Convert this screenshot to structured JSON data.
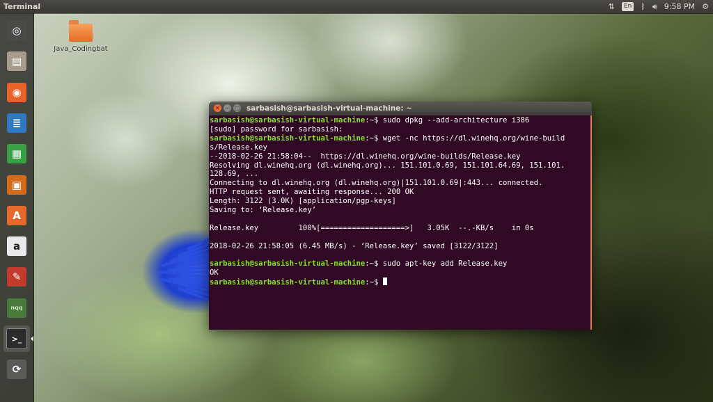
{
  "top_panel": {
    "app_title": "Terminal",
    "keyboard_layout": "En",
    "clock": "9:58 PM",
    "icons": [
      "network-transfer-icon",
      "keyboard-layout-icon",
      "bluetooth-icon",
      "volume-icon",
      "gear-icon"
    ]
  },
  "launcher": {
    "items": [
      {
        "name": "dash-home",
        "icon": "ubuntu-logo-icon",
        "color": "#4a4a48"
      },
      {
        "name": "files",
        "icon": "file-cabinet-icon",
        "color": "#a79c8c"
      },
      {
        "name": "firefox",
        "icon": "firefox-icon",
        "color": "#e8622a"
      },
      {
        "name": "libreoffice-writer",
        "icon": "writer-icon",
        "color": "#2f78c4"
      },
      {
        "name": "libreoffice-calc",
        "icon": "calc-icon",
        "color": "#3aa046"
      },
      {
        "name": "libreoffice-impress",
        "icon": "impress-icon",
        "color": "#d46b1c"
      },
      {
        "name": "ubuntu-software",
        "icon": "software-bag-icon",
        "color": "#e5682d"
      },
      {
        "name": "amazon",
        "icon": "amazon-icon",
        "color": "#e9e9e9"
      },
      {
        "name": "system-settings",
        "icon": "settings-tools-icon",
        "color": "#c33b2c"
      },
      {
        "name": "nqq",
        "icon": "nqq-editor-icon",
        "color": "#4a7a3a"
      },
      {
        "name": "terminal",
        "icon": "terminal-icon",
        "color": "#2c2c2c"
      },
      {
        "name": "software-updater",
        "icon": "updater-icon",
        "color": "#5a5a58"
      }
    ],
    "nqq_label": "nqq"
  },
  "desktop": {
    "folder_label": "Java_Codingbat"
  },
  "terminal": {
    "title": "sarbasish@sarbasish-virtual-machine: ~",
    "prompt": "sarbasish@sarbasish-virtual-machine",
    "prompt_suffix": ":~$ ",
    "lines": [
      {
        "type": "cmd",
        "text": "sudo dpkg --add-architecture i386"
      },
      {
        "type": "out",
        "text": "[sudo] password for sarbasish:"
      },
      {
        "type": "cmd",
        "text": "wget -nc https://dl.winehq.org/wine-build"
      },
      {
        "type": "out",
        "text": "s/Release.key"
      },
      {
        "type": "out",
        "text": "--2018-02-26 21:58:04--  https://dl.winehq.org/wine-builds/Release.key"
      },
      {
        "type": "out",
        "text": "Resolving dl.winehq.org (dl.winehq.org)... 151.101.0.69, 151.101.64.69, 151.101."
      },
      {
        "type": "out",
        "text": "128.69, ..."
      },
      {
        "type": "out",
        "text": "Connecting to dl.winehq.org (dl.winehq.org)|151.101.0.69|:443... connected."
      },
      {
        "type": "out",
        "text": "HTTP request sent, awaiting response... 200 OK"
      },
      {
        "type": "out",
        "text": "Length: 3122 (3.0K) [application/pgp-keys]"
      },
      {
        "type": "out",
        "text": "Saving to: ‘Release.key’"
      },
      {
        "type": "out",
        "text": ""
      },
      {
        "type": "out",
        "text": "Release.key         100%[===================>]   3.05K  --.-KB/s    in 0s"
      },
      {
        "type": "out",
        "text": ""
      },
      {
        "type": "out",
        "text": "2018-02-26 21:58:05 (6.45 MB/s) - ‘Release.key’ saved [3122/3122]"
      },
      {
        "type": "out",
        "text": ""
      },
      {
        "type": "cmd",
        "text": "sudo apt-key add Release.key"
      },
      {
        "type": "out",
        "text": "OK"
      },
      {
        "type": "cmd",
        "text": ""
      }
    ]
  }
}
